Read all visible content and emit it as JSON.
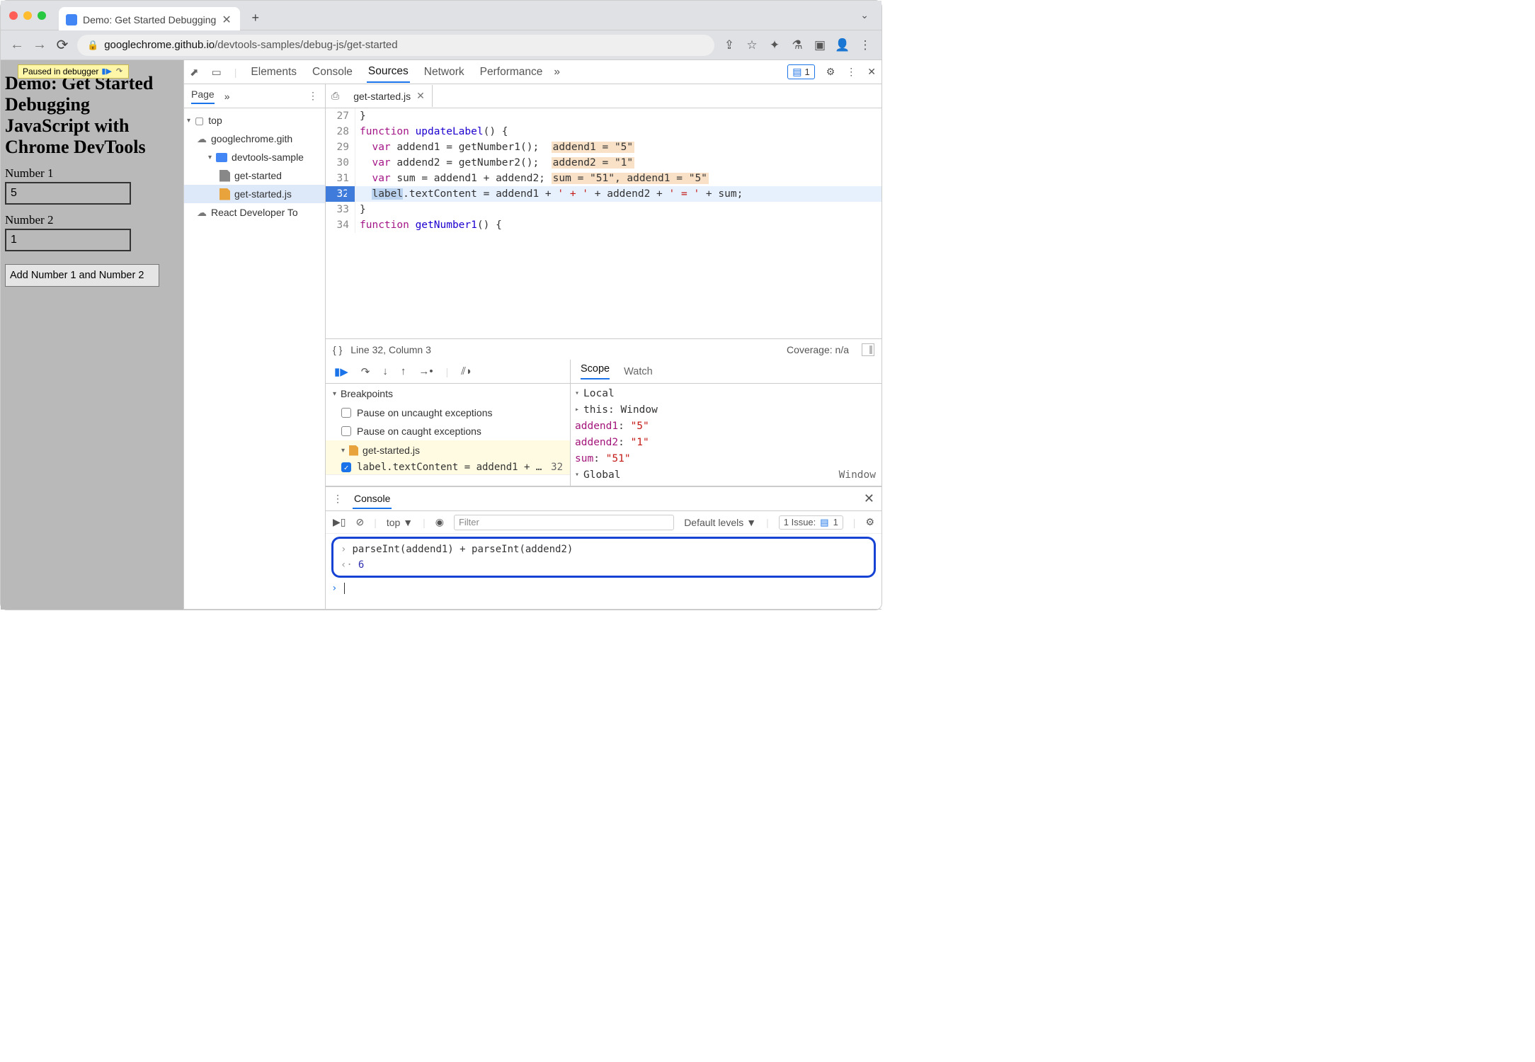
{
  "browser": {
    "tab_title": "Demo: Get Started Debugging",
    "url_host": "googlechrome.github.io",
    "url_path": "/devtools-samples/debug-js/get-started"
  },
  "page": {
    "paused_label": "Paused in debugger",
    "heading": "Demo: Get Started Debugging JavaScript with Chrome DevTools",
    "num1_label": "Number 1",
    "num1_value": "5",
    "num2_label": "Number 2",
    "num2_value": "1",
    "button_label": "Add Number 1 and Number 2"
  },
  "devtools": {
    "tabs": [
      "Elements",
      "Console",
      "Sources",
      "Network",
      "Performance"
    ],
    "active_tab": "Sources",
    "issues_badge": "1",
    "navigator": {
      "tab": "Page",
      "items": {
        "top": "top",
        "cloud1": "googlechrome.gith",
        "folder": "devtools-sample",
        "file_html": "get-started",
        "file_js": "get-started.js",
        "cloud2": "React Developer To"
      }
    },
    "editor": {
      "filename": "get-started.js",
      "lines": {
        "l27": "}",
        "l28_kw": "function",
        "l28_fn": "updateLabel",
        "l28_rest": "() {",
        "l29_kw": "var",
        "l29_rest": " addend1 = getNumber1();",
        "l29_hint": "addend1 = \"5\"",
        "l30_kw": "var",
        "l30_rest": " addend2 = getNumber2();",
        "l30_hint": "addend2 = \"1\"",
        "l31_kw": "var",
        "l31_rest": " sum = addend1 + addend2;",
        "l31_hint": "sum = \"51\", addend1 = \"5\"",
        "l32_a": "label",
        "l32_b": ".textContent = addend1 + ",
        "l32_s1": "' + '",
        "l32_c": " + addend2 + ",
        "l32_s2": "' = '",
        "l32_d": " + sum;",
        "l33": "}",
        "l34_kw": "function",
        "l34_fn": "getNumber1",
        "l34_rest": "() {"
      },
      "status_pos": "Line 32, Column 3",
      "coverage": "Coverage: n/a"
    },
    "breakpoints": {
      "title": "Breakpoints",
      "uncaught": "Pause on uncaught exceptions",
      "caught": "Pause on caught exceptions",
      "file": "get-started.js",
      "text": "label.textContent = addend1 + ' …",
      "line": "32"
    },
    "scope": {
      "tabs": [
        "Scope",
        "Watch"
      ],
      "local": "Local",
      "this_k": "this",
      "this_v": "Window",
      "a1_k": "addend1",
      "a1_v": "\"5\"",
      "a2_k": "addend2",
      "a2_v": "\"1\"",
      "sum_k": "sum",
      "sum_v": "\"51\"",
      "global": "Global",
      "global_v": "Window"
    },
    "console": {
      "tab": "Console",
      "context": "top",
      "filter_ph": "Filter",
      "levels": "Default levels",
      "issue_label": "1 Issue:",
      "issue_count": "1",
      "in": "parseInt(addend1) + parseInt(addend2)",
      "out": "6"
    }
  }
}
